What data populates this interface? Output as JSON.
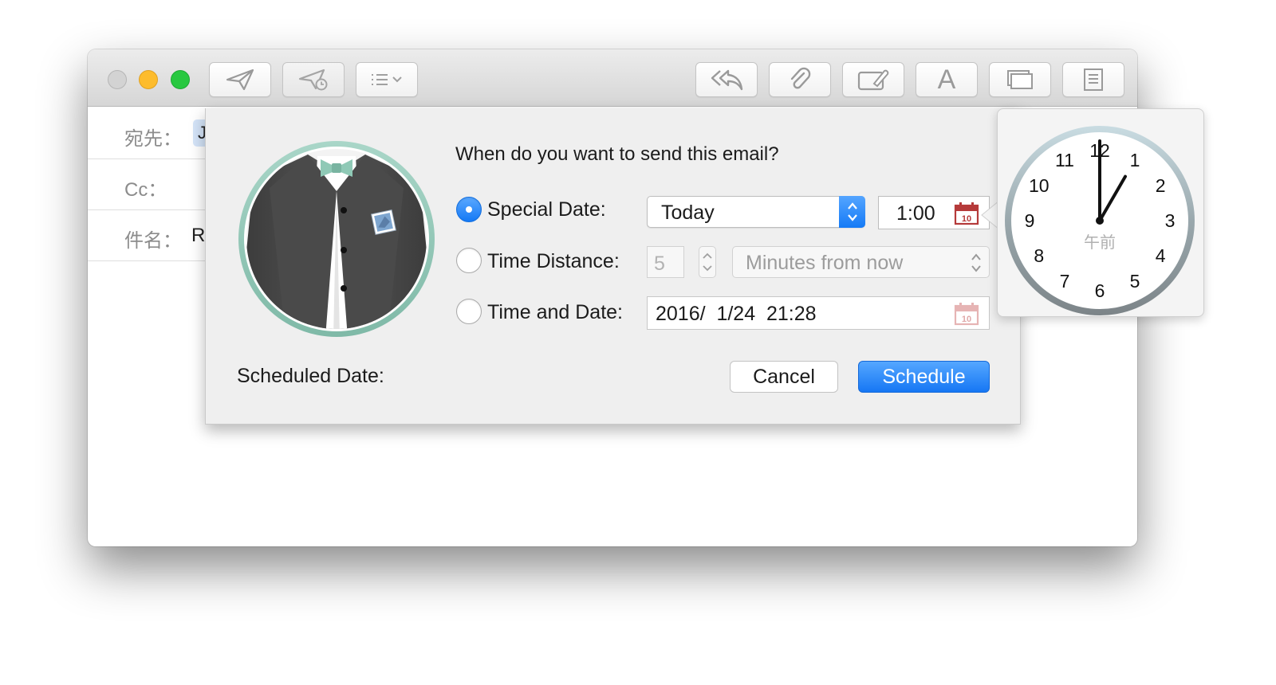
{
  "toolbar": {
    "buttons": [
      {
        "name": "send-icon"
      },
      {
        "name": "send-later-icon"
      },
      {
        "name": "header-fields-icon"
      },
      {
        "name": "reply-all-icon"
      },
      {
        "name": "attachment-icon"
      },
      {
        "name": "markup-icon"
      },
      {
        "name": "format-text-icon",
        "glyph": "A"
      },
      {
        "name": "photo-browser-icon"
      },
      {
        "name": "stationery-icon"
      }
    ]
  },
  "compose": {
    "to_label": "宛先：",
    "to_value": "J",
    "cc_label": "Cc：",
    "subject_label": "件名：",
    "subject_value": "R"
  },
  "dialog": {
    "question": "When do you want to send this email?",
    "special_date_label": "Special Date:",
    "special_date_selected": true,
    "special_date_value": "Today",
    "special_time_value": "1:00",
    "time_distance_label": "Time Distance:",
    "time_distance_selected": false,
    "time_distance_amount": "5",
    "time_distance_unit": "Minutes from now",
    "time_and_date_label": "Time and Date:",
    "time_and_date_selected": false,
    "time_and_date_value": "2016/  1/24  21:28",
    "scheduled_date_label": "Scheduled Date:",
    "cancel_label": "Cancel",
    "schedule_label": "Schedule",
    "calendar_icon_text": "10"
  },
  "clock": {
    "numbers": [
      "12",
      "1",
      "2",
      "3",
      "4",
      "5",
      "6",
      "7",
      "8",
      "9",
      "10",
      "11"
    ],
    "period_label": "午前",
    "hour": 1,
    "minute": 0
  },
  "colors": {
    "accent": "#1677f4",
    "calendar_red": "#b53a3a",
    "close_gray": "#d3d3d3",
    "minimize_yellow": "#fdbc2d",
    "zoom_green": "#28c840"
  }
}
